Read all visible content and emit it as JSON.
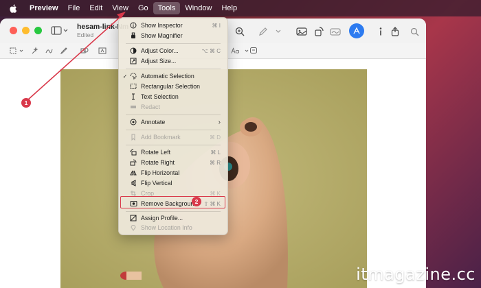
{
  "menubar": {
    "items": [
      {
        "label": "Preview"
      },
      {
        "label": "File"
      },
      {
        "label": "Edit"
      },
      {
        "label": "View"
      },
      {
        "label": "Go"
      },
      {
        "label": "Tools"
      },
      {
        "label": "Window"
      },
      {
        "label": "Help"
      }
    ]
  },
  "document": {
    "title": "hesam-link-Nm",
    "subtitle": "Edited"
  },
  "tools_menu": {
    "items": [
      {
        "label": "Show Inspector",
        "shortcut": "⌘ I",
        "icon": "info-icon",
        "enabled": true
      },
      {
        "label": "Show Magnifier",
        "shortcut": "",
        "icon": "magnifier-icon",
        "enabled": true
      },
      {
        "label": "Adjust Color...",
        "shortcut": "⌥ ⌘ C",
        "icon": "color-icon",
        "enabled": true
      },
      {
        "label": "Adjust Size...",
        "shortcut": "",
        "icon": "resize-icon",
        "enabled": true
      },
      {
        "label": "Automatic Selection",
        "shortcut": "",
        "icon": "auto-select-icon",
        "enabled": true,
        "checked": true
      },
      {
        "label": "Rectangular Selection",
        "shortcut": "",
        "icon": "rect-select-icon",
        "enabled": true
      },
      {
        "label": "Text Selection",
        "shortcut": "",
        "icon": "text-select-icon",
        "enabled": true
      },
      {
        "label": "Redact",
        "shortcut": "",
        "icon": "redact-icon",
        "enabled": false
      },
      {
        "label": "Annotate",
        "shortcut": "›",
        "icon": "annotate-icon",
        "enabled": true
      },
      {
        "label": "Add Bookmark",
        "shortcut": "⌘ D",
        "icon": "bookmark-icon",
        "enabled": false
      },
      {
        "label": "Rotate Left",
        "shortcut": "⌘ L",
        "icon": "rotate-left-icon",
        "enabled": true
      },
      {
        "label": "Rotate Right",
        "shortcut": "⌘ R",
        "icon": "rotate-right-icon",
        "enabled": true
      },
      {
        "label": "Flip Horizontal",
        "shortcut": "",
        "icon": "flip-horizontal-icon",
        "enabled": true
      },
      {
        "label": "Flip Vertical",
        "shortcut": "",
        "icon": "flip-vertical-icon",
        "enabled": true
      },
      {
        "label": "Crop",
        "shortcut": "⌘ K",
        "icon": "crop-icon",
        "enabled": false
      },
      {
        "label": "Remove Background",
        "shortcut": "⇧ ⌘ K",
        "icon": "remove-background-icon",
        "enabled": true
      },
      {
        "label": "Assign Profile...",
        "shortcut": "",
        "icon": "profile-icon",
        "enabled": true
      },
      {
        "label": "Show Location Info",
        "shortcut": "",
        "icon": "location-icon",
        "enabled": false
      }
    ]
  },
  "annotations": {
    "badge1": "1",
    "badge2": "2",
    "color": "#d9384a"
  },
  "watermark": "itmagazine.cc",
  "colors": {
    "accent": "#2d7bf0",
    "photo_background": "#b7ad6a"
  }
}
